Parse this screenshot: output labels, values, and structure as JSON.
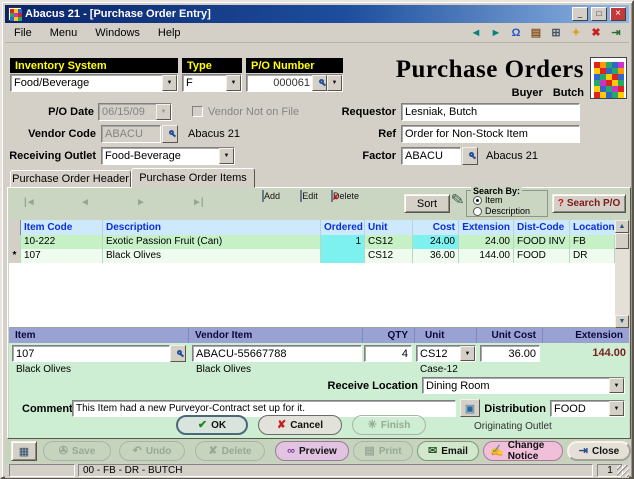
{
  "window": {
    "title": "Abacus 21 - [Purchase Order Entry]"
  },
  "menu": {
    "items": [
      "File",
      "Menu",
      "Windows",
      "Help"
    ]
  },
  "header": {
    "inventory_system_label": "Inventory System",
    "inventory_system_value": "Food/Beverage",
    "type_label": "Type",
    "type_value": "F",
    "po_number_label": "P/O Number",
    "po_number_value": "000061",
    "title": "Purchase Orders",
    "buyer_label": "Buyer",
    "buyer_value": "Butch"
  },
  "form": {
    "po_date_label": "P/O Date",
    "po_date_value": "06/15/09",
    "vendor_not_on_file_label": "Vendor Not on File",
    "requestor_label": "Requestor",
    "requestor_value": "Lesniak, Butch",
    "vendor_code_label": "Vendor Code",
    "vendor_code_value": "ABACU",
    "vendor_name": "Abacus 21",
    "ref_label": "Ref",
    "ref_value": "Order for Non-Stock Item",
    "receiving_outlet_label": "Receiving Outlet",
    "receiving_outlet_value": "Food-Beverage",
    "factor_label": "Factor",
    "factor_value": "ABACU",
    "factor_name": "Abacus 21"
  },
  "tabs": {
    "header": "Purchase Order Header",
    "items": "Purchase Order Items"
  },
  "grid_toolbar": {
    "add": "Add",
    "edit": "Edit",
    "delete": "Delete",
    "sort": "Sort",
    "search_by": "Search By:",
    "option_item": "Item",
    "option_description": "Description",
    "search_po": "Search P/O"
  },
  "grid": {
    "columns": [
      "Item Code",
      "Description",
      "Ordered",
      "Unit",
      "Cost",
      "Extension",
      "Dist-Code",
      "Location"
    ],
    "rows": [
      {
        "indicator": "",
        "item_code": "10-222",
        "description": "Exotic Passion Fruit (Can)",
        "ordered": "1",
        "unit": "CS12",
        "cost": "24.00",
        "extension": "24.00",
        "dist_code": "FOOD INV",
        "location": "FB"
      },
      {
        "indicator": "*",
        "item_code": "107",
        "description": "Black Olives",
        "ordered": "",
        "unit": "CS12",
        "cost": "36.00",
        "extension": "144.00",
        "dist_code": "FOOD",
        "location": "DR"
      }
    ]
  },
  "detail": {
    "item_label": "Item",
    "vendor_item_label": "Vendor Item",
    "qty_label": "QTY",
    "unit_label": "Unit",
    "unit_cost_label": "Unit Cost",
    "extension_label": "Extension",
    "item_value": "107",
    "vendor_item_value": "ABACU-55667788",
    "qty_value": "4",
    "unit_value": "CS12",
    "unit_cost_value": "36.00",
    "extension_value": "144.00",
    "item_desc": "Black Olives",
    "vendor_item_desc": "Black Olives",
    "unit_desc": "Case-12",
    "receive_location_label": "Receive Location",
    "receive_location_value": "Dining Room",
    "comment_label": "Comment",
    "comment_value": "This Item had a new Purveyor-Contract set up for it.",
    "distribution_label": "Distribution",
    "distribution_value": "FOOD",
    "ok": "OK",
    "cancel": "Cancel",
    "finish": "Finish",
    "originating_outlet": "Originating Outlet"
  },
  "bottom": {
    "save": "Save",
    "undo": "Undo",
    "delete": "Delete",
    "preview": "Preview",
    "print": "Print",
    "email": "Email",
    "change_notice": "Change Notice",
    "close": "Close"
  },
  "status": {
    "text": "00 - FB - DR - BUTCH",
    "page": "1"
  },
  "colors": {
    "titlebar_blue": "#0a246a",
    "label_yellow": "#ffff00",
    "grid_header_blue": "#0b2fd4",
    "highlight_cyan": "#7df0f0",
    "mint_green": "#cdeed2",
    "lavender": "#9aa2d4"
  },
  "icons": {
    "minimize": "_",
    "maximize": "□",
    "close": "×",
    "nav_back": "◄",
    "nav_forward": "►",
    "bell": "Ω",
    "book": "▤",
    "calculator": "⊞",
    "runner": "✦",
    "exit": "✖",
    "door": "⇥",
    "vcr_first": "|◄",
    "vcr_prev": "◄",
    "vcr_next": "►",
    "vcr_last": "►|",
    "pencil": "✎",
    "question": "?",
    "dropdown": "▼",
    "scroll_up": "▲",
    "scroll_down": "▼",
    "check": "✔",
    "cross": "✘",
    "finish": "✳",
    "picture": "▣",
    "save": "✇",
    "undo": "↶",
    "preview": "∞",
    "print": "▤",
    "email": "✉",
    "change_notice": "✍",
    "grid_button": "▦"
  }
}
